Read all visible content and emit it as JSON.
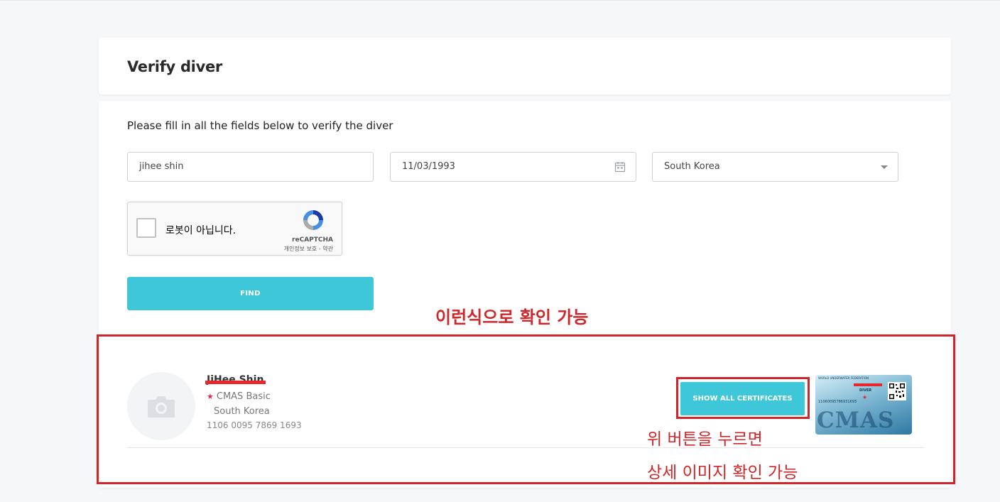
{
  "page": {
    "title": "Verify diver",
    "instructions": "Please fill in all the fields below to verify the diver"
  },
  "form": {
    "name_value": "jihee shin",
    "birthdate_value": "11/03/1993",
    "country_value": "South Korea",
    "find_label": "FIND"
  },
  "captcha": {
    "label": "로봇이 아닙니다.",
    "brand": "reCAPTCHA",
    "links": "개인정보 보호 - 약관"
  },
  "result": {
    "name": "JiHee Shin",
    "certification": "CMAS Basic",
    "country": "South Korea",
    "number": "1106 0095 7869 1693",
    "show_all_label": "SHOW ALL CERTIFICATES",
    "card": {
      "title": "WORLD UNDERWATER FEDERATION",
      "level": "DIVER",
      "number": "11060095786931693",
      "logo": "CMAS"
    }
  },
  "annotations": {
    "check_note": "이런식으로 확인 가능",
    "button_note": "위 버튼을 누르면",
    "detail_note": "상세 이미지 확인 가능"
  },
  "colors": {
    "accent": "#3ec7d8",
    "annotation_red": "#d0262a",
    "star_red": "#e02a4d"
  },
  "icons": {
    "calendar": "calendar-icon",
    "dropdown": "chevron-down-icon",
    "camera": "camera-icon",
    "recaptcha": "recaptcha-logo-icon",
    "star": "star-icon"
  }
}
